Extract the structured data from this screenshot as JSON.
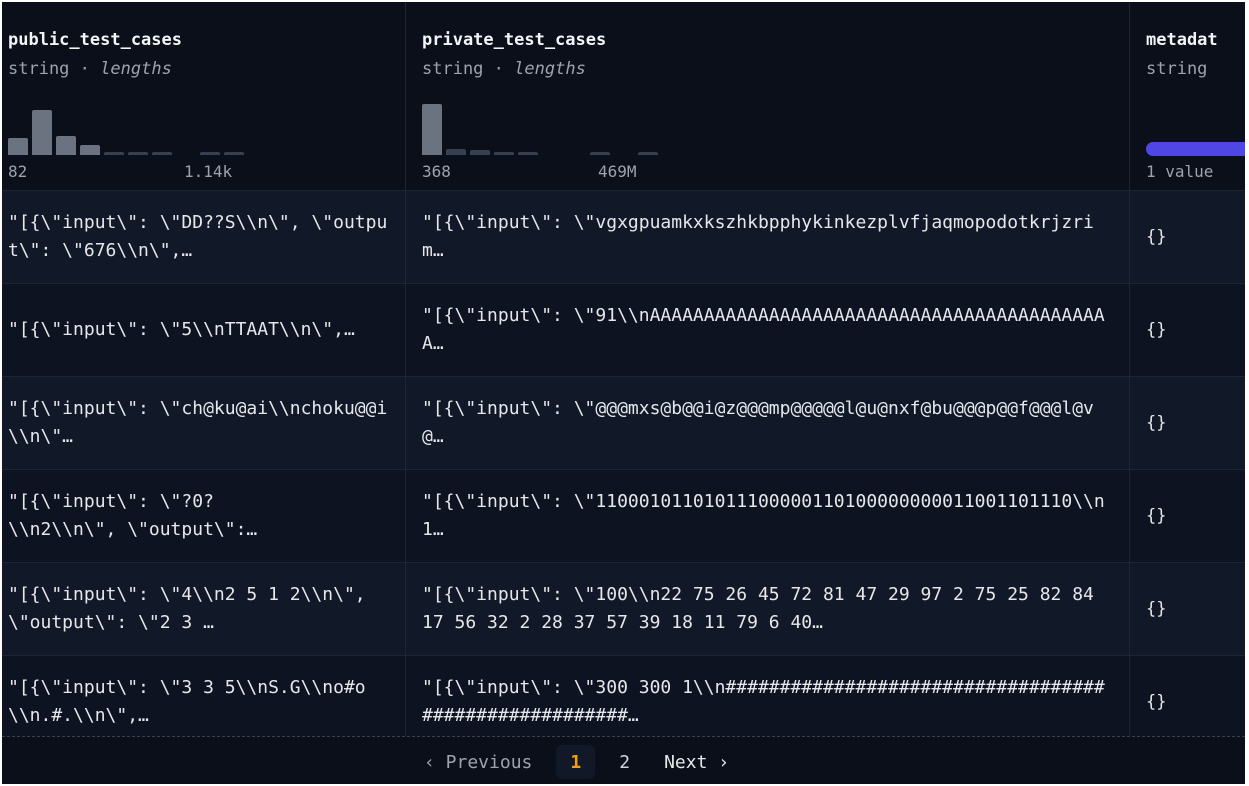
{
  "columns": [
    {
      "name": "public_test_cases",
      "type": "string",
      "sep": "·",
      "lengths_label": "lengths",
      "range_min": "82",
      "range_max": "1.14k",
      "histogram": [
        0.3,
        0.78,
        0.32,
        0.18,
        0.05,
        0.05,
        0.05,
        0,
        0.05,
        0.05
      ]
    },
    {
      "name": "private_test_cases",
      "type": "string",
      "sep": "·",
      "lengths_label": "lengths",
      "range_min": "368",
      "range_max": "469M",
      "histogram": [
        0.88,
        0.1,
        0.08,
        0.06,
        0.05,
        0,
        0,
        0.04,
        0,
        0.04
      ]
    },
    {
      "name": "metadat",
      "type": "string",
      "range_min": "1 value"
    }
  ],
  "rows": [
    {
      "public": "\"[{\\\"input\\\": \\\"DD??S\\\\n\\\", \\\"output\\\": \\\"676\\\\n\\\",…",
      "private": "\"[{\\\"input\\\": \\\"vgxgpuamkxkszhkbpphykinkezplvfjaqmopodotkrjzrim…",
      "meta": "{}"
    },
    {
      "public": "\"[{\\\"input\\\": \\\"5\\\\nTTAAT\\\\n\\\",…",
      "private": "\"[{\\\"input\\\": \\\"91\\\\nAAAAAAAAAAAAAAAAAAAAAAAAAAAAAAAAAAAAAAAAAAA…",
      "meta": "{}"
    },
    {
      "public": "\"[{\\\"input\\\": \\\"ch@ku@ai\\\\nchoku@@i\\\\n\\\"…",
      "private": "\"[{\\\"input\\\": \\\"@@@mxs@b@@i@z@@@mp@@@@@l@u@nxf@bu@@@p@@f@@@l@v@…",
      "meta": "{}"
    },
    {
      "public": "\"[{\\\"input\\\": \\\"?0?\n\\\\n2\\\\n\\\", \\\"output\\\":…",
      "private": "\"[{\\\"input\\\": \\\"11000101101011100000110100000000011001101110\\\\n1…",
      "meta": "{}"
    },
    {
      "public": "\"[{\\\"input\\\": \\\"4\\\\n2 5 1 2\\\\n\\\", \\\"output\\\": \\\"2 3 …",
      "private": "\"[{\\\"input\\\": \\\"100\\\\n22 75 26 45 72 81 47 29 97 2 75 25 82 84 17 56 32 2 28 37 57 39 18 11 79 6 40…",
      "meta": "{}"
    },
    {
      "public": "\"[{\\\"input\\\": \\\"3 3 5\\\\nS.G\\\\no#o\\\\n.#.\\\\n\\\",…",
      "private": "\"[{\\\"input\\\": \\\"300 300 1\\\\n######################################################…",
      "meta": "{}"
    }
  ],
  "pagination": {
    "previous": "‹ Previous",
    "pages": [
      "1",
      "2"
    ],
    "current": "1",
    "next": "Next ›"
  }
}
